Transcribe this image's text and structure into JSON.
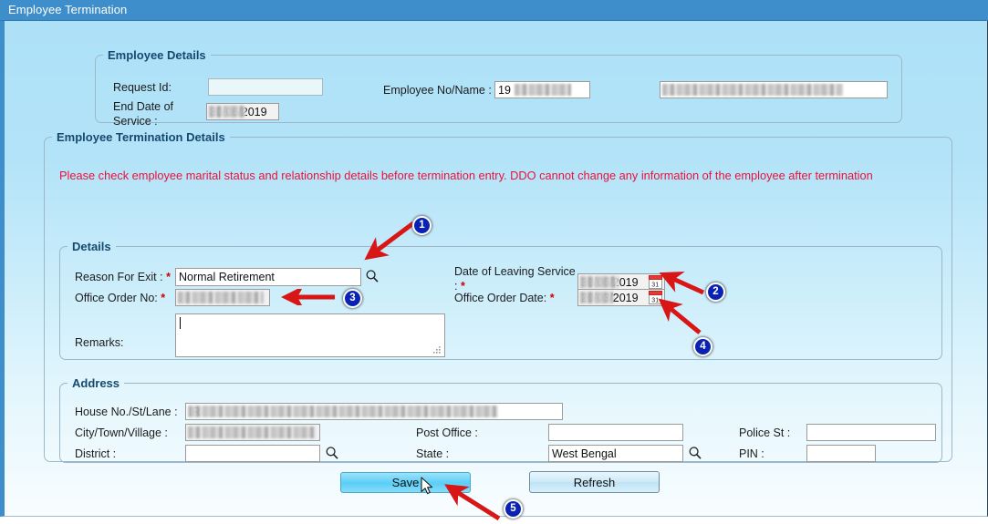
{
  "window": {
    "title": "Employee Termination"
  },
  "employee_details": {
    "legend": "Employee Details",
    "request_id_label": "Request Id:",
    "request_id_value": "",
    "end_date_label_line1": "End Date of",
    "end_date_label_line2": "Service :",
    "end_date_value": "30/06/2019",
    "employee_no_name_label": "Employee No/Name :",
    "employee_no_value": "19",
    "employee_name_value": "",
    "required_marker": "*"
  },
  "termination_details": {
    "legend": "Employee Termination Details",
    "warning": "Please check employee marital status and relationship details before termination entry. DDO cannot change any information of the employee after termination"
  },
  "details": {
    "legend": "Details",
    "reason_label": "Reason For Exit :",
    "reason_value": "Normal Retirement",
    "office_order_no_label": "Office Order No:",
    "office_order_no_value": "",
    "remarks_label": "Remarks:",
    "remarks_value": "",
    "date_of_leaving_label_line1": "Date of Leaving Service",
    "date_of_leaving_label_line2": ":",
    "date_of_leaving_value": "30/06/2019",
    "office_order_date_label": "Office Order Date:",
    "office_order_date_value": "20/03/2019",
    "required_marker": "*",
    "search_icon": "search-icon",
    "calendar_icon": "calendar-icon"
  },
  "address": {
    "legend": "Address",
    "house_label": "House No./St/Lane :",
    "house_value": "IR",
    "city_label": "City/Town/Village :",
    "city_value": "",
    "district_label": "District :",
    "district_value": "",
    "post_office_label": "Post Office :",
    "post_office_value": "",
    "state_label": "State :",
    "state_value": "West Bengal",
    "police_st_label": "Police St :",
    "police_st_value": "",
    "pin_label": "PIN :",
    "pin_value": ""
  },
  "actions": {
    "save_label": "Save",
    "refresh_label": "Refresh"
  },
  "annotations": {
    "markers": [
      "1",
      "2",
      "3",
      "4",
      "5"
    ]
  },
  "colors": {
    "titlebar": "#3d8ecb",
    "page_top": "#ade1f8",
    "legend_text": "#16496f",
    "warning_text": "#e8123c",
    "required_star": "#d00000",
    "badge_fill": "#0a22b4",
    "arrow_red": "#d81616",
    "button_hover": "#5ccef6"
  }
}
